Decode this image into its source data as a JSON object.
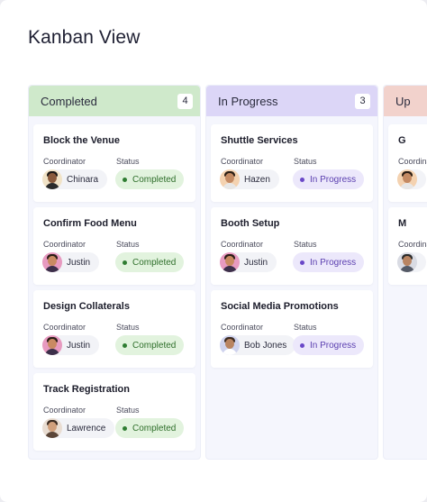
{
  "page": {
    "title": "Kanban View"
  },
  "labels": {
    "coordinator": "Coordinator",
    "status": "Status"
  },
  "colors": {
    "completed_header": "#cfe9cb",
    "inprogress_header": "#dcd6f7",
    "upcoming_header": "#f2d2cc",
    "completed_pill_bg": "#e2f3de",
    "completed_pill_text": "#2f6f2b",
    "completed_dot": "#2f7d32",
    "inprogress_pill_bg": "#ece8fb",
    "inprogress_pill_text": "#5b3fb0",
    "inprogress_dot": "#6a48c8"
  },
  "columns": [
    {
      "title": "Completed",
      "count": "4",
      "cards": [
        {
          "title": "Block the Venue",
          "coordinator": "Chinara",
          "status": "Completed"
        },
        {
          "title": "Confirm Food Menu",
          "coordinator": "Justin",
          "status": "Completed"
        },
        {
          "title": "Design Collaterals",
          "coordinator": "Justin",
          "status": "Completed"
        },
        {
          "title": "Track Registration",
          "coordinator": "Lawrence",
          "status": "Completed"
        }
      ]
    },
    {
      "title": "In Progress",
      "count": "3",
      "cards": [
        {
          "title": "Shuttle Services",
          "coordinator": "Hazen",
          "status": "In Progress"
        },
        {
          "title": "Booth Setup",
          "coordinator": "Justin",
          "status": "In Progress"
        },
        {
          "title": "Social Media Promotions",
          "coordinator": "Bob Jones",
          "status": "In Progress"
        }
      ]
    },
    {
      "title": "Up",
      "count": "",
      "cards": [
        {
          "title": "G",
          "coordinator": "",
          "status": ""
        },
        {
          "title": "M",
          "coordinator": "",
          "status": ""
        }
      ]
    }
  ]
}
